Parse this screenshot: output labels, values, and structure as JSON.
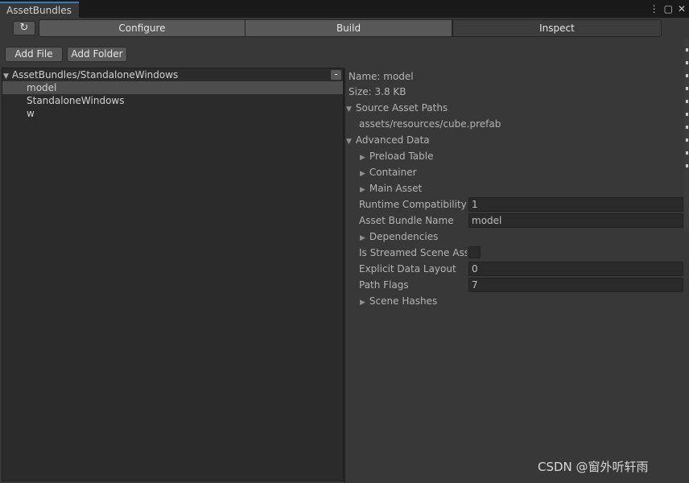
{
  "window": {
    "tab_title": "AssetBundles",
    "menu_icon": "⋮",
    "maximize_icon": "▢",
    "close_icon": "✕"
  },
  "toolbar": {
    "refresh_icon": "↻",
    "tabs": [
      {
        "label": "Configure"
      },
      {
        "label": "Build"
      },
      {
        "label": "Inspect"
      }
    ],
    "active_tab": "Inspect",
    "add_file_label": "Add File",
    "add_folder_label": "Add Folder"
  },
  "tree": {
    "root_label": "AssetBundles/StandaloneWindows",
    "remove_label": "-",
    "items": [
      {
        "label": "model",
        "selected": true
      },
      {
        "label": "StandaloneWindows",
        "selected": false
      },
      {
        "label": "w",
        "selected": false
      }
    ]
  },
  "inspector": {
    "name": "Name: model",
    "size": "Size: 3.8 KB",
    "source_asset_paths_label": "Source Asset Paths",
    "source_path": "assets/resources/cube.prefab",
    "advanced_data_label": "Advanced Data",
    "preload_table_label": "Preload Table",
    "container_label": "Container",
    "main_asset_label": "Main Asset",
    "runtime_compat_label": "Runtime Compatibility",
    "runtime_compat_value": "1",
    "bundle_name_label": "Asset Bundle Name",
    "bundle_name_value": "model",
    "dependencies_label": "Dependencies",
    "streamed_label": "Is Streamed Scene Asse",
    "streamed_checked": false,
    "explicit_layout_label": "Explicit Data Layout",
    "explicit_layout_value": "0",
    "path_flags_label": "Path Flags",
    "path_flags_value": "7",
    "scene_hashes_label": "Scene Hashes"
  },
  "watermark": "CSDN @窗外听轩雨",
  "colors": {
    "tab_accent": "#3a79bb",
    "background": "#383838",
    "panel": "#2b2b2b",
    "selection": "#4d4d4d"
  }
}
